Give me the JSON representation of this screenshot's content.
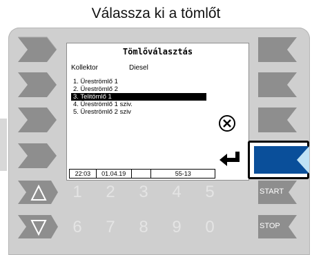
{
  "caption": "Válassza ki a tömlőt",
  "screen": {
    "title": "Tömlőválasztás",
    "collector_label": "Kollektor",
    "collector_value": "Diesel",
    "items": [
      "1.  Üreströmlő 1",
      "2.  Üreströmlő 2",
      "3.  Telitömlő 1",
      "4.  Üreströmlő 1 sziv.",
      "5.  Üreströmlő 2 sziv"
    ],
    "selected_index": 2,
    "status": {
      "time": "22:03",
      "date": "01.04.19",
      "blank": "",
      "code": "55-13"
    }
  },
  "keypad": {
    "row1": [
      "1",
      "2",
      "3",
      "4",
      "5"
    ],
    "row2": [
      "6",
      "7",
      "8",
      "9",
      "0"
    ]
  },
  "side_buttons": {
    "start": "START",
    "stop": "STOP"
  },
  "icons": {
    "cancel": "cancel-circle-x-icon",
    "enter": "enter-return-icon",
    "up": "triangle-up-icon",
    "down": "triangle-down-icon"
  },
  "colors": {
    "active_button": "#0a4f9a",
    "button": "#8c8c8c",
    "key_text": "#e4e4e4"
  }
}
